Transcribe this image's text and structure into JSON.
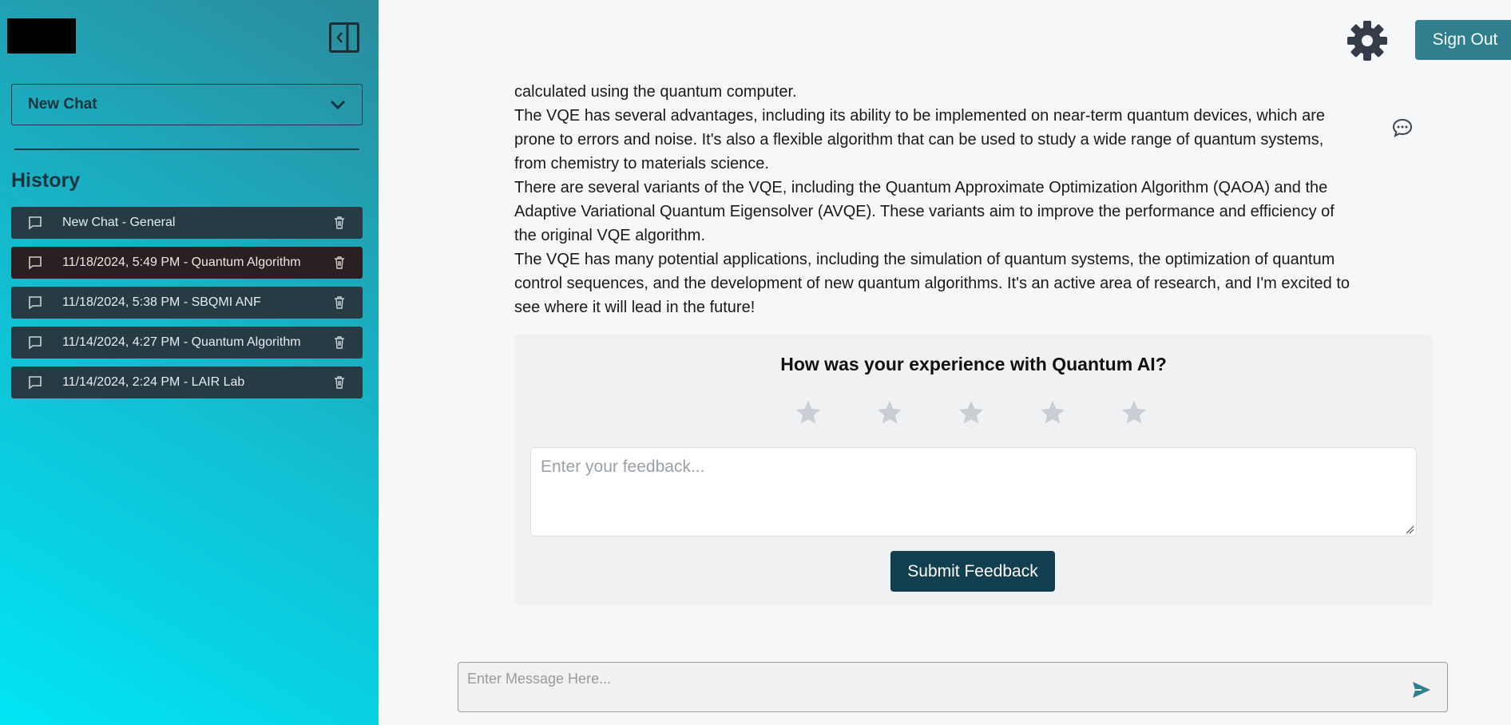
{
  "sidebar": {
    "new_chat_label": "New Chat",
    "history_title": "History",
    "items": [
      {
        "label": "New Chat - General",
        "active": false
      },
      {
        "label": "11/18/2024, 5:49 PM - Quantum Algorithm",
        "active": true
      },
      {
        "label": "11/18/2024, 5:38 PM - SBQMI ANF",
        "active": false
      },
      {
        "label": "11/14/2024, 4:27 PM - Quantum Algorithm",
        "active": false
      },
      {
        "label": "11/14/2024, 2:24 PM - LAIR Lab",
        "active": false
      }
    ]
  },
  "header": {
    "signout_label": "Sign Out"
  },
  "message": {
    "paragraphs": [
      "calculated using the quantum computer.",
      "The VQE has several advantages, including its ability to be implemented on near-term quantum devices, which are prone to errors and noise. It's also a flexible algorithm that can be used to study a wide range of quantum systems, from chemistry to materials science.",
      "There are several variants of the VQE, including the Quantum Approximate Optimization Algorithm (QAOA) and the Adaptive Variational Quantum Eigensolver (AVQE). These variants aim to improve the performance and efficiency of the original VQE algorithm.",
      "The VQE has many potential applications, including the simulation of quantum systems, the optimization of quantum control sequences, and the development of new quantum algorithms. It's an active area of research, and I'm excited to see where it will lead in the future!"
    ]
  },
  "feedback": {
    "title": "How was your experience with Quantum AI?",
    "rating": 0,
    "max_rating": 5,
    "placeholder": "Enter your feedback...",
    "submit_label": "Submit Feedback"
  },
  "composer": {
    "placeholder": "Enter Message Here..."
  },
  "colors": {
    "accent": "#2f7f8f",
    "submit": "#123f50",
    "history_item": "#263b44",
    "history_item_active": "#2a1f22"
  }
}
